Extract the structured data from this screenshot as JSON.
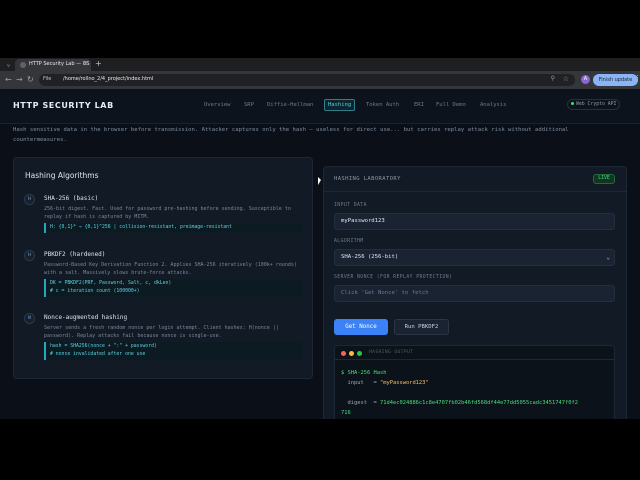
{
  "browser": {
    "tab_title": "HTTP Security Lab — CS",
    "tab_close": "×",
    "new_tab": "+",
    "chip": "File",
    "url": "/home/rollno_2/4_project/index.html",
    "avatar_letter": "A",
    "finish_update": "Finish update"
  },
  "header": {
    "logo": "HTTP SECURITY LAB",
    "nav": [
      "Overview",
      "SRP",
      "Diffie-Hellman",
      "Hashing",
      "Token Auth",
      "ERI",
      "Full Demo",
      "Analysis"
    ],
    "active_nav": "Hashing",
    "webcrypto": "Web Crypto API"
  },
  "intro": "Hash sensitive data in the browser before transmission. Attacker captures only the hash — useless for direct use... but carries replay attack risk without additional countermeasures.",
  "algorithms": {
    "title": "Hashing Algorithms",
    "items": [
      {
        "badge": "H",
        "name": "SHA-256 (basic)",
        "desc": "256-bit digest. Fast. Used for password pre-hashing before sending. Susceptible to replay if hash is captured by MITM.",
        "code": [
          "H: {0,1}* → {0,1}^256 | collision-resistant, preimage-resistant"
        ]
      },
      {
        "badge": "H",
        "name": "PBKDF2 (hardened)",
        "desc": "Password-Based Key Derivation Function 2. Applies SHA-256 iteratively (100k+ rounds) with a salt. Massively slows brute-force attacks.",
        "code": [
          "DK = PBKDF2(PRF, Password, Salt, c, dkLen)",
          "# c = iteration count (100000+)"
        ]
      },
      {
        "badge": "N",
        "name": "Nonce-augmented hashing",
        "desc": "Server sends a fresh random nonce per login attempt. Client hashes: H(nonce || password). Replay attacks fail because nonce is single-use.",
        "code": [
          "hash = SHA256(nonce + \":\" + password)",
          "# nonce invalidated after one use"
        ]
      }
    ]
  },
  "lab": {
    "title": "HASHING LABORATORY",
    "live": "LIVE",
    "input_label": "INPUT DATA",
    "input_value": "myPassword123",
    "algo_label": "ALGORITHM",
    "algo_value": "SHA-256 (256-bit)",
    "nonce_label": "SERVER NONCE (FOR REPLAY PROTECTION)",
    "nonce_placeholder": "Click 'Get Nonce' to fetch",
    "get_nonce": "Get Nonce",
    "run_pbkdf2": "Run PBKDF2",
    "output_title": "HASHING OUTPUT",
    "output_heading": "$ SHA-256 Hash",
    "input_key": "input",
    "input_eq": "=",
    "input_str": "\"myPassword123\"",
    "digest_key": "digest",
    "digest_eq": "=",
    "digest_part1": "71d4ec024886c1c8e4707fb02b46fd568df44e77dd5055cadc3451747f0f2",
    "digest_part2": "716"
  },
  "colors": {
    "accent": "#4dd0e1",
    "primary_button": "#3b82f6",
    "live_green": "#3ddc84",
    "mac_red": "#ff5f57",
    "mac_yellow": "#febc2e",
    "mac_green": "#28c840"
  }
}
